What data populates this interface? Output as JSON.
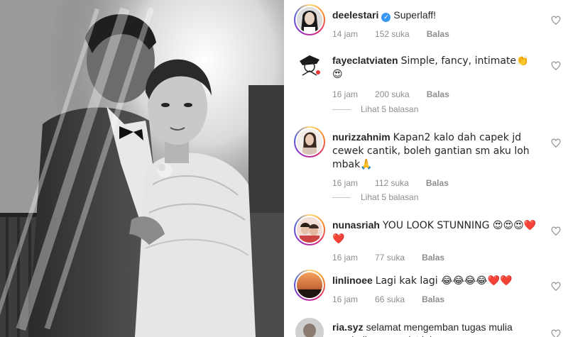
{
  "comments": [
    {
      "username": "deelestari",
      "verified": true,
      "text": "Superlaff!",
      "time": "14 jam",
      "likes": "152 suka",
      "reply": "Balas",
      "avatar": "woman-portrait"
    },
    {
      "username": "fayeclatviaten",
      "verified": false,
      "text": "Simple, fancy, intimate👏😍",
      "time": "16 jam",
      "likes": "200 suka",
      "reply": "Balas",
      "view_replies": "Lihat 5 balasan",
      "avatar": "cartoon-sketch"
    },
    {
      "username": "nurizzahnim",
      "verified": false,
      "text": "Kapan2 kalo dah capek jd cewek cantik, boleh gantian sm aku loh mbak🙏",
      "time": "16 jam",
      "likes": "112 suka",
      "reply": "Balas",
      "view_replies": "Lihat 5 balasan",
      "avatar": "woman-photo"
    },
    {
      "username": "nunasriah",
      "verified": false,
      "text": "YOU LOOK STUNNING 😍😍😍❤️❤️",
      "time": "16 jam",
      "likes": "77 suka",
      "reply": "Balas",
      "avatar": "two-girls"
    },
    {
      "username": "linlinoee",
      "verified": false,
      "text": "Lagi kak lagi 😂😂😂😂❤️❤️",
      "time": "16 jam",
      "likes": "66 suka",
      "reply": "Balas",
      "avatar": "sunset-landscape"
    },
    {
      "username": "ria.syz",
      "verified": false,
      "text": "selamat mengemban tugas mulia menjadi seorang istri, ke",
      "avatar": "person-photo"
    }
  ],
  "icons": {
    "verified": "verified-badge-icon",
    "like": "heart-outline-icon"
  },
  "colors": {
    "verified_blue": "#3897f0",
    "meta_gray": "#8e8e8e",
    "text": "#262626"
  }
}
